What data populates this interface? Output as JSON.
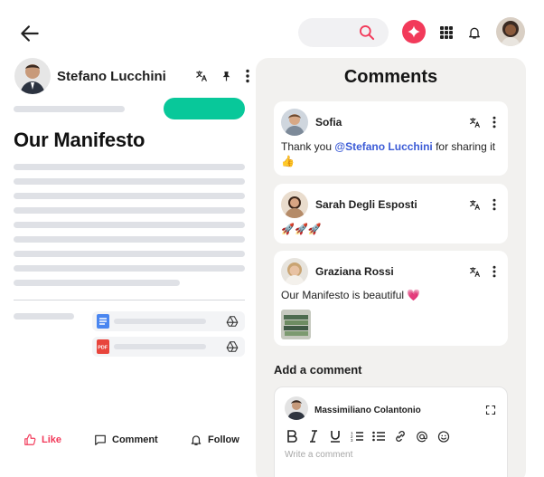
{
  "post": {
    "author_name": "Stefano Lucchini",
    "title": "Our Manifesto"
  },
  "actions": {
    "like_label": "Like",
    "comment_label": "Comment",
    "follow_label": "Follow"
  },
  "comments_panel": {
    "title": "Comments",
    "comments": [
      {
        "author": "Sofia",
        "text_before": "Thank you ",
        "mention": "@Stefano Lucchini",
        "text_after": " for sharing it 👍"
      },
      {
        "author": "Sarah Degli Esposti",
        "text": "🚀🚀🚀"
      },
      {
        "author": "Graziana Rossi",
        "text": "Our Manifesto is beautiful 💗"
      }
    ],
    "add_comment_title": "Add a comment",
    "editor": {
      "user_name": "Massimiliano Colantonio",
      "placeholder": "Write a comment"
    }
  },
  "colors": {
    "accent_red": "#f23a5a",
    "accent_green": "#08c89a",
    "mention_blue": "#3b5bd6",
    "panel_bg": "#f2f1ef"
  },
  "icons": [
    "back-arrow-icon",
    "search-icon",
    "sparkle-icon",
    "apps-grid-icon",
    "bell-icon",
    "translate-icon",
    "pin-icon",
    "more-vertical-icon",
    "google-docs-icon",
    "pdf-icon",
    "google-drive-icon",
    "thumb-up-icon",
    "comment-icon",
    "expand-icon",
    "bold-icon",
    "italic-icon",
    "underline-icon",
    "ordered-list-icon",
    "bullet-list-icon",
    "link-icon",
    "at-icon",
    "emoji-icon"
  ]
}
